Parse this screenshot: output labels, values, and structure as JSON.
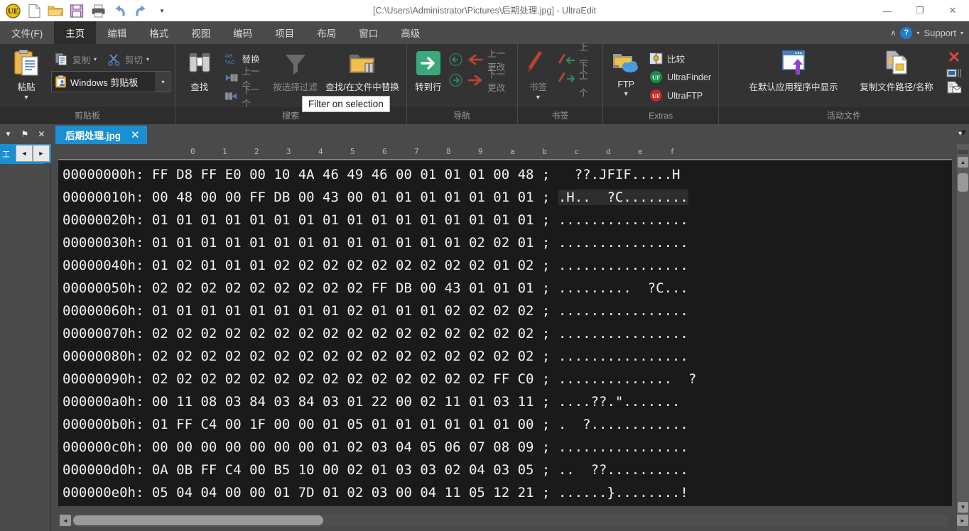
{
  "window": {
    "title": "[C:\\Users\\Administrator\\Pictures\\后期处理.jpg] - UltraEdit",
    "minimize_label": "—",
    "restore_label": "❐",
    "close_label": "✕"
  },
  "quick_access": [
    {
      "name": "app-logo",
      "label": "UE"
    },
    {
      "name": "new-file",
      "label": "New"
    },
    {
      "name": "open-file",
      "label": "Open"
    },
    {
      "name": "save-file",
      "label": "Save"
    },
    {
      "name": "print-file",
      "label": "Print"
    },
    {
      "name": "undo",
      "label": "Undo"
    },
    {
      "name": "redo",
      "label": "Redo"
    },
    {
      "name": "qat-more",
      "label": "▾"
    }
  ],
  "menubar": {
    "items": [
      {
        "label": "文件(F)",
        "active": false
      },
      {
        "label": "主页",
        "active": true
      },
      {
        "label": "编辑",
        "active": false
      },
      {
        "label": "格式",
        "active": false
      },
      {
        "label": "视图",
        "active": false
      },
      {
        "label": "编码",
        "active": false
      },
      {
        "label": "项目",
        "active": false
      },
      {
        "label": "布局",
        "active": false
      },
      {
        "label": "窗口",
        "active": false
      },
      {
        "label": "高级",
        "active": false
      }
    ],
    "collapse_caret": "∧",
    "help_label": "?",
    "help_caret": "▾",
    "support_label": "Support",
    "support_caret": "▾"
  },
  "ribbon": {
    "groups": [
      {
        "name": "clipboard",
        "label": "剪贴板",
        "paste_label": "粘贴",
        "paste_caret": "▼",
        "copy_label": "复制",
        "copy_caret": "▾",
        "cut_label": "剪切",
        "cut_caret": "▾",
        "clipboard_combo_value": "Windows 剪贴板",
        "clipboard_combo_caret": "▾"
      },
      {
        "name": "search",
        "label": "搜索",
        "find_label": "查找",
        "replace_label": "替换",
        "prev_label": "上一个",
        "next_label": "下一个",
        "filter_label": "按选择过滤",
        "find_in_files_label": "查找/在文件中替换"
      },
      {
        "name": "navigation",
        "label": "导航",
        "goto_line_label": "转到行",
        "back_label": "Back",
        "forward_label": "Forward",
        "prev_change_label": "上一更改",
        "next_change_label": "下一更改"
      },
      {
        "name": "bookmarks",
        "label": "书签",
        "bookmark_label": "书签",
        "bookmark_caret": "▼",
        "prev_bookmark_label": "上一个",
        "next_bookmark_label": "下一个"
      },
      {
        "name": "extras",
        "label": "Extras",
        "ftp_label": "FTP",
        "ftp_caret": "▼",
        "compare_label": "比较",
        "ultrafinder_label": "UltraFinder",
        "ultraftp_label": "UltraFTP"
      },
      {
        "name": "active-files",
        "label": "活动文件",
        "show_in_default_app_label": "在默认应用程序中显示",
        "copy_file_path_label": "复制文件路径/名称",
        "close_file_label": "✕"
      }
    ]
  },
  "tooltip": {
    "text": "Filter on selection"
  },
  "tabstrip": {
    "panel_dropdown": "▼",
    "panel_pin": "⚑",
    "panel_close": "✕",
    "document_tab": {
      "label": "后期处理.jpg",
      "close": "✕"
    },
    "overflow_caret": "▾"
  },
  "left_panel": {
    "active_tab_label": "工",
    "nav_prev": "◄",
    "nav_next": "►"
  },
  "editor": {
    "ruler": [
      "0",
      "1",
      "2",
      "3",
      "4",
      "5",
      "6",
      "7",
      "8",
      "9",
      "a",
      "b",
      "c",
      "d",
      "e",
      "f"
    ],
    "separator": ";",
    "lines": [
      {
        "address": "00000000h:",
        "hex": "FF D8 FF E0 00 10 4A 46 49 46 00 01 01 01 00 48",
        "ascii": "  ??.JFIF.....H",
        "selected": false
      },
      {
        "address": "00000010h:",
        "hex": "00 48 00 00 FF DB 00 43 00 01 01 01 01 01 01 01",
        "ascii": ".H..  ?C........",
        "selected": true
      },
      {
        "address": "00000020h:",
        "hex": "01 01 01 01 01 01 01 01 01 01 01 01 01 01 01 01",
        "ascii": "................",
        "selected": false
      },
      {
        "address": "00000030h:",
        "hex": "01 01 01 01 01 01 01 01 01 01 01 01 01 02 02 01",
        "ascii": "................",
        "selected": false
      },
      {
        "address": "00000040h:",
        "hex": "01 02 01 01 01 02 02 02 02 02 02 02 02 02 01 02",
        "ascii": "................",
        "selected": false
      },
      {
        "address": "00000050h:",
        "hex": "02 02 02 02 02 02 02 02 02 FF DB 00 43 01 01 01",
        "ascii": ".........  ?C...",
        "selected": false
      },
      {
        "address": "00000060h:",
        "hex": "01 01 01 01 01 01 01 01 02 01 01 01 02 02 02 02",
        "ascii": "................",
        "selected": false
      },
      {
        "address": "00000070h:",
        "hex": "02 02 02 02 02 02 02 02 02 02 02 02 02 02 02 02",
        "ascii": "................",
        "selected": false
      },
      {
        "address": "00000080h:",
        "hex": "02 02 02 02 02 02 02 02 02 02 02 02 02 02 02 02",
        "ascii": "................",
        "selected": false
      },
      {
        "address": "00000090h:",
        "hex": "02 02 02 02 02 02 02 02 02 02 02 02 02 02 FF C0",
        "ascii": "..............  ?",
        "selected": false
      },
      {
        "address": "000000a0h:",
        "hex": "00 11 08 03 84 03 84 03 01 22 00 02 11 01 03 11",
        "ascii": "....??.\".......",
        "selected": false
      },
      {
        "address": "000000b0h:",
        "hex": "01 FF C4 00 1F 00 00 01 05 01 01 01 01 01 01 00",
        "ascii": ".  ?............",
        "selected": false
      },
      {
        "address": "000000c0h:",
        "hex": "00 00 00 00 00 00 00 01 02 03 04 05 06 07 08 09",
        "ascii": "................",
        "selected": false
      },
      {
        "address": "000000d0h:",
        "hex": "0A 0B FF C4 00 B5 10 00 02 01 03 03 02 04 03 05",
        "ascii": "..  ??..........",
        "selected": false
      },
      {
        "address": "000000e0h:",
        "hex": "05 04 04 00 00 01 7D 01 02 03 00 04 11 05 12 21",
        "ascii": "......}........!",
        "selected": false
      }
    ]
  },
  "scrollbars": {
    "vertical": {
      "caret": "▼",
      "up": "▲",
      "down": "▼"
    },
    "horizontal": {
      "left": "◄",
      "right": "►"
    }
  },
  "colors": {
    "accent": "#1b8fd4",
    "ribbon_bg": "#333333",
    "menu_bg": "#4a4a4a",
    "editor_bg": "#1a1a1a",
    "editor_fg": "#f2f2f2",
    "close_red": "#d9443c",
    "go_green": "#3aa87a"
  }
}
